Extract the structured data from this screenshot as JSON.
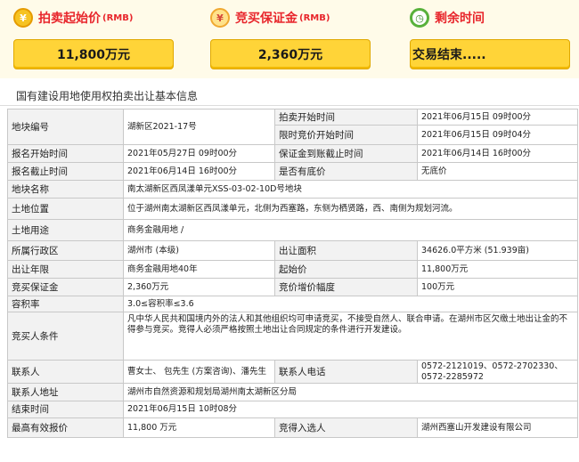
{
  "cards": {
    "start_price": {
      "label": "拍卖起始价",
      "unit": "(RMB)",
      "value": "11,800万元"
    },
    "deposit": {
      "label": "竞买保证金",
      "unit": "(RMB)",
      "value": "2,360万元"
    },
    "time_left": {
      "label": "剩余时间",
      "value": "交易结束....."
    }
  },
  "section_title": "国有建设用地使用权拍卖出让基本信息",
  "info": {
    "parcel_no_k": "地块编号",
    "parcel_no_v": "湖新区2021-17号",
    "auction_start_k": "拍卖开始时间",
    "auction_start_v": "2021年06月15日 09时00分",
    "bid_start_k": "限时竞价开始时间",
    "bid_start_v": "2021年06月15日 09时04分",
    "reg_start_k": "报名开始时间",
    "reg_start_v": "2021年05月27日 09时00分",
    "deposit_deadline_k": "保证金到账截止时间",
    "deposit_deadline_v": "2021年06月14日 16时00分",
    "reg_end_k": "报名截止时间",
    "reg_end_v": "2021年06月14日 16时00分",
    "reserve_k": "是否有底价",
    "reserve_v": "无底价",
    "name_k": "地块名称",
    "name_v": "南太湖新区西凤漾单元XSS-03-02-10D号地块",
    "location_k": "土地位置",
    "location_v": "位于湖州南太湖新区西凤漾单元，北侧为西塞路，东侧为栖贤路，西、南侧为规划河流。",
    "use_k": "土地用途",
    "use_v": "商务金融用地 /",
    "district_k": "所属行政区",
    "district_v": "湖州市 (本级)",
    "area_k": "出让面积",
    "area_v": "34626.0平方米 (51.939亩)",
    "term_k": "出让年限",
    "term_v": "商务金融用地40年",
    "start_price_k": "起始价",
    "start_price_v": "11,800万元",
    "bid_deposit_k": "竞买保证金",
    "bid_deposit_v": "2,360万元",
    "increment_k": "竞价增价幅度",
    "increment_v": "100万元",
    "far_k": "容积率",
    "far_v": "3.0≤容积率≤3.6",
    "conditions_k": "竞买人条件",
    "conditions_v": "凡中华人民共和国境内外的法人和其他组织均可申请竞买，不接受自然人、联合申请。在湖州市区欠缴土地出让金的不得参与竞买。竞得人必须严格按照土地出让合同规定的条件进行开发建设。",
    "contact_k": "联系人",
    "contact_v": "曹女士、 包先生 (方案咨询)、潘先生",
    "phone_k": "联系人电话",
    "phone_v": "0572-2121019、0572-2702330、0572-2285972",
    "address_k": "联系人地址",
    "address_v": "湖州市自然资源和规划局湖州南太湖新区分局",
    "end_time_k": "结束时间",
    "end_time_v": "2021年06月15日 10时08分",
    "top_bid_k": "最高有效报价",
    "top_bid_v": "11,800  万元",
    "winner_k": "竞得入选人",
    "winner_v": "湖州西塞山开发建设有限公司"
  }
}
